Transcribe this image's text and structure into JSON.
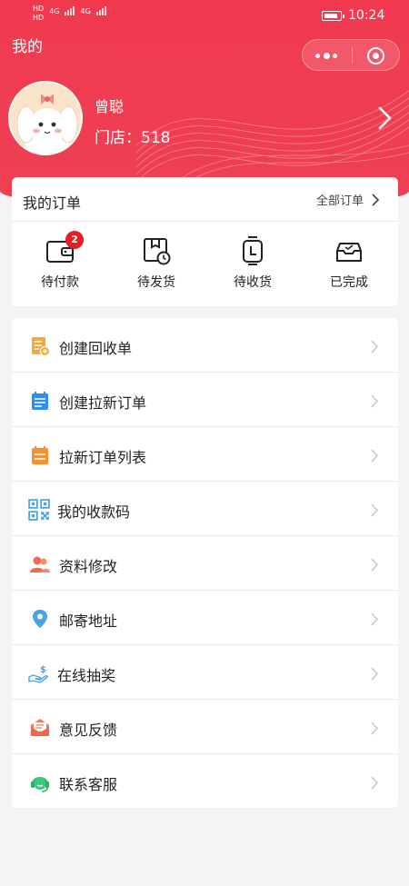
{
  "status_bar": {
    "left_text_1": "HD",
    "left_text_2": "HD",
    "net_1": "4G",
    "net_2": "4G",
    "time": "10:24"
  },
  "header": {
    "title": "我的",
    "bg_color": "#f0394f"
  },
  "user": {
    "name": "曾聪",
    "store": "门店：518"
  },
  "orders": {
    "title": "我的订单",
    "all_label": "全部订单",
    "items": [
      {
        "label": "待付款",
        "icon": "wallet-icon",
        "badge": "2"
      },
      {
        "label": "待发货",
        "icon": "package-clock-icon"
      },
      {
        "label": "待收货",
        "icon": "watch-icon"
      },
      {
        "label": "已完成",
        "icon": "inbox-check-icon"
      }
    ]
  },
  "menu": {
    "items": [
      {
        "label": "创建回收单",
        "icon": "recycle-doc-icon",
        "color": "#f4a93a"
      },
      {
        "label": "创建拉新订单",
        "icon": "calendar-icon",
        "color": "#2c8ef0"
      },
      {
        "label": "拉新订单列表",
        "icon": "calendar-list-icon",
        "color": "#f7922a"
      },
      {
        "label": "我的收款码",
        "icon": "qr-code-icon",
        "color": "#4aa3e8"
      },
      {
        "label": "资料修改",
        "icon": "users-icon",
        "color": "#f26b4f"
      },
      {
        "label": "邮寄地址",
        "icon": "location-pin-icon",
        "color": "#4aa3e8"
      },
      {
        "label": "在线抽奖",
        "icon": "hand-coin-icon",
        "color": "#4aa3e8"
      },
      {
        "label": "意见反馈",
        "icon": "mail-open-icon",
        "color": "#f47a55"
      },
      {
        "label": "联系客服",
        "icon": "headset-icon",
        "color": "#3cc77c"
      }
    ]
  }
}
